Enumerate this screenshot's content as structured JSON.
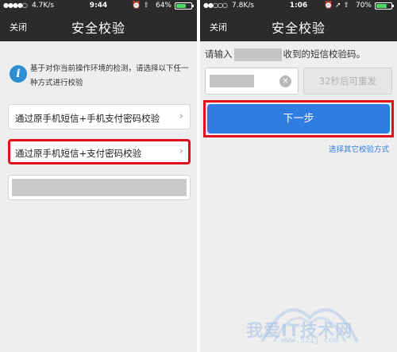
{
  "left": {
    "status": {
      "signal": "●●●●○",
      "speed": "4.7K/s",
      "time": "9:44",
      "icons": "⏰ ⇧",
      "battery": "64%",
      "battery_level": 0.64
    },
    "nav": {
      "close": "关闭",
      "title": "安全校验"
    },
    "info": {
      "icon": "info-icon",
      "text": "基于对你当前操作环境的检测，请选择以下任一种方式进行校验"
    },
    "options": [
      {
        "label": "通过原手机短信+手机支付密码校验",
        "chevron": "›"
      },
      {
        "label": "通过原手机短信+支付密码校验",
        "chevron": "›"
      },
      {
        "label": ""
      }
    ]
  },
  "right": {
    "status": {
      "signal": "●●○○○",
      "speed": "7.8K/s",
      "time": "1:06",
      "icons": "⏰ ➚ ⇧",
      "battery": "70%",
      "battery_level": 0.7
    },
    "nav": {
      "close": "关闭",
      "title": "安全校验"
    },
    "prompt": {
      "prefix": "请输入",
      "suffix": "收到的短信校验码。"
    },
    "input": {
      "clear_icon": "✕"
    },
    "resend": "32秒后可重发",
    "next": "下一步",
    "other_link": "选择其它校验方式"
  },
  "watermark": {
    "text": "我爱IT技术网",
    "url": "www.52ij.com"
  },
  "colors": {
    "accent": "#2f7de1",
    "highlight": "#e00f1c",
    "bar": "#2b2b2b"
  }
}
